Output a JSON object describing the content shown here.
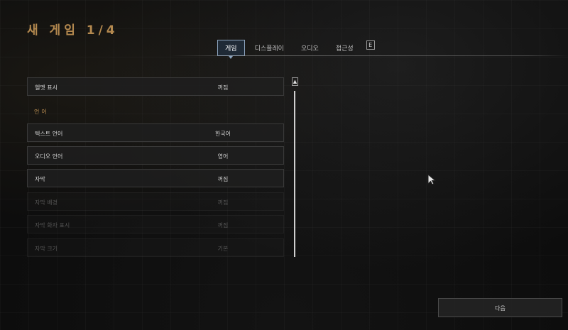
{
  "header": {
    "title": "새 게임 1/4"
  },
  "tabs": [
    {
      "label": "게임",
      "active": true
    },
    {
      "label": "디스플레이",
      "active": false
    },
    {
      "label": "오디오",
      "active": false
    },
    {
      "label": "접근성",
      "active": false
    }
  ],
  "tab_key_hint": "E",
  "settings": {
    "row0": {
      "label": "헬멧 표시",
      "value": "꺼짐"
    },
    "section_language": "언어",
    "row1": {
      "label": "텍스트 언어",
      "value": "한국어"
    },
    "row2": {
      "label": "오디오 언어",
      "value": "영어"
    },
    "row3": {
      "label": "자막",
      "value": "꺼짐"
    },
    "row4": {
      "label": "자막 배경",
      "value": "꺼짐"
    },
    "row5": {
      "label": "자막 화자 표시",
      "value": "꺼짐"
    },
    "row6": {
      "label": "자막 크기",
      "value": "기본"
    }
  },
  "scroll_up_glyph": "▲",
  "footer": {
    "next_label": "다음"
  },
  "colors": {
    "accent": "#b4894f",
    "tab_active_bg": "#1f2a36",
    "tab_active_border": "#8ea6c0"
  }
}
